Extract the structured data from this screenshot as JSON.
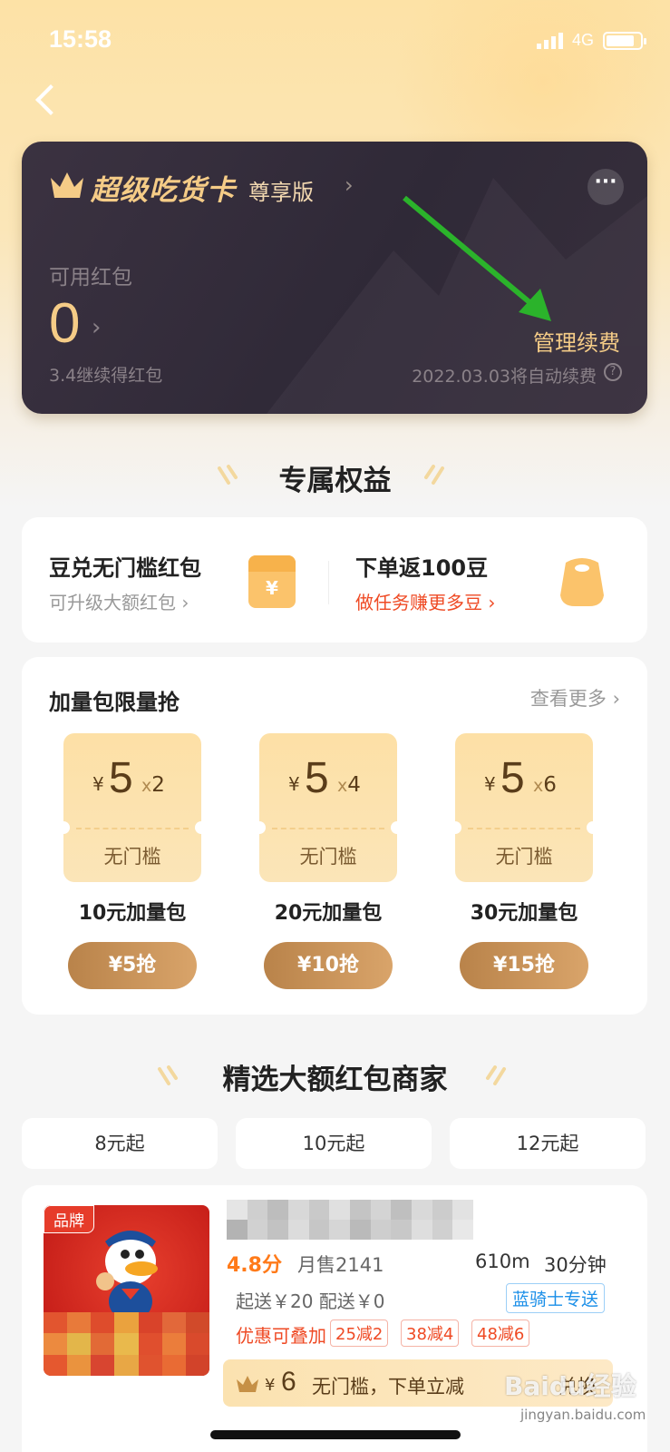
{
  "status_bar": {
    "time": "15:58",
    "network": "4G"
  },
  "vip_card": {
    "title": "超级吃货卡",
    "tier": "尊享版",
    "tier_arrow": "›",
    "more": "···",
    "redpacket_label": "可用红包",
    "redpacket_count": "0",
    "redpacket_arrow": "›",
    "redpacket_sub": "3.4继续得红包",
    "manage_renew": "管理续费",
    "auto_renew_text": "2022.03.03将自动续费",
    "help": "?"
  },
  "benefits": {
    "section_title": "专属权益",
    "left": {
      "title": "豆兑无门槛红包",
      "sub": "可升级大额红包 ›",
      "icon_text": "¥"
    },
    "right": {
      "title": "下单返100豆",
      "sub": "做任务赚更多豆 ›"
    }
  },
  "packs": {
    "title": "加量包限量抢",
    "see_more": "查看更多 ›",
    "items": [
      {
        "yen": "¥",
        "amount": "5",
        "x": "x",
        "qty": "2",
        "tag": "无门槛",
        "name": "10元加量包",
        "button": "¥5抢"
      },
      {
        "yen": "¥",
        "amount": "5",
        "x": "x",
        "qty": "4",
        "tag": "无门槛",
        "name": "20元加量包",
        "button": "¥10抢"
      },
      {
        "yen": "¥",
        "amount": "5",
        "x": "x",
        "qty": "6",
        "tag": "无门槛",
        "name": "30元加量包",
        "button": "¥15抢"
      }
    ]
  },
  "merchants": {
    "section_title": "精选大额红包商家",
    "filters": [
      "8元起",
      "10元起",
      "12元起"
    ]
  },
  "shop": {
    "brand_tag": "品牌",
    "rating": "4.8分",
    "monthly_sales": "月售2141",
    "distance": "610m",
    "delivery_time": "30分钟",
    "fees": "起送￥20  配送￥0",
    "rider_badge": "蓝骑士专送",
    "promo_label": "优惠可叠加",
    "promo_tags": [
      "25减2",
      "38减4",
      "48减6"
    ],
    "promo_bar": {
      "yen": "¥",
      "amount": "6",
      "desc": "无门槛，下单立减",
      "action": "兑换"
    }
  },
  "watermark": {
    "text": "Baidu经验",
    "sub": "jingyan.baidu.com"
  },
  "colors": {
    "gold": "#f5cc87",
    "card_dark": "#2f2937",
    "accent_red": "#ef4a24",
    "button_brown": "#c08c55"
  }
}
